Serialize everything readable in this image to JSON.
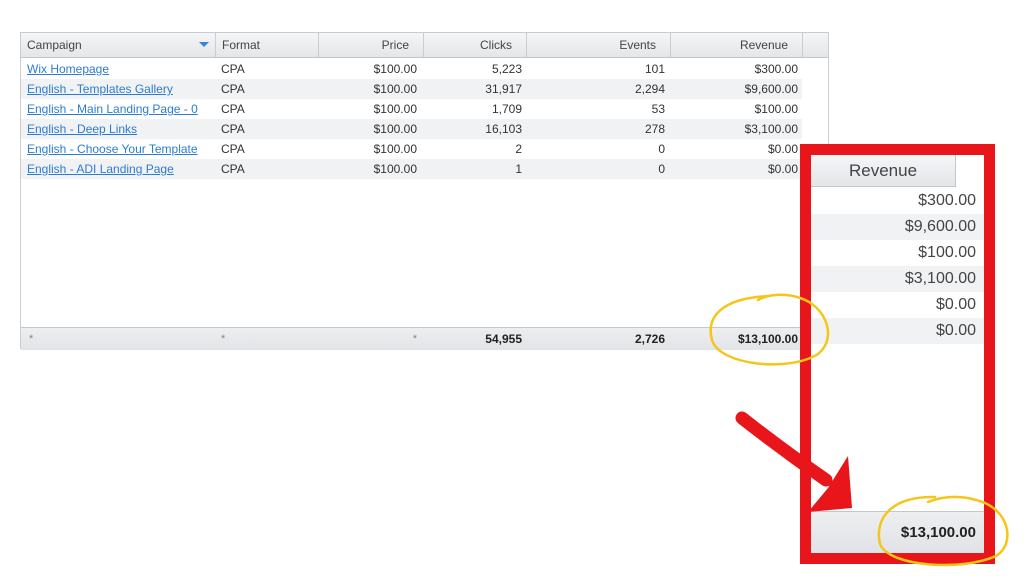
{
  "grid": {
    "columns": [
      "Campaign",
      "Format",
      "Price",
      "Clicks",
      "Events",
      "Revenue"
    ],
    "rows": [
      {
        "campaign": "Wix Homepage",
        "format": "CPA",
        "price": "$100.00",
        "clicks": "5,223",
        "events": "101",
        "revenue": "$300.00"
      },
      {
        "campaign": "English - Templates Gallery",
        "format": "CPA",
        "price": "$100.00",
        "clicks": "31,917",
        "events": "2,294",
        "revenue": "$9,600.00"
      },
      {
        "campaign": "English - Main Landing Page - 0",
        "format": "CPA",
        "price": "$100.00",
        "clicks": "1,709",
        "events": "53",
        "revenue": "$100.00"
      },
      {
        "campaign": "English - Deep Links",
        "format": "CPA",
        "price": "$100.00",
        "clicks": "16,103",
        "events": "278",
        "revenue": "$3,100.00"
      },
      {
        "campaign": "English - Choose Your Template",
        "format": "CPA",
        "price": "$100.00",
        "clicks": "2",
        "events": "0",
        "revenue": "$0.00"
      },
      {
        "campaign": "English - ADI Landing Page",
        "format": "CPA",
        "price": "$100.00",
        "clicks": "1",
        "events": "0",
        "revenue": "$0.00"
      }
    ],
    "footer": {
      "campaign": "*",
      "format": "*",
      "price": "*",
      "clicks": "54,955",
      "events": "2,726",
      "revenue": "$13,100.00"
    }
  },
  "zoom": {
    "header": "Revenue",
    "values": [
      "$300.00",
      "$9,600.00",
      "$100.00",
      "$3,100.00",
      "$0.00",
      "$0.00"
    ],
    "total": "$13,100.00"
  },
  "colors": {
    "link": "#2b7cd3",
    "highlight_box": "#e8151b",
    "arrow": "#e8151b",
    "circle_annotation": "#f5c518"
  }
}
